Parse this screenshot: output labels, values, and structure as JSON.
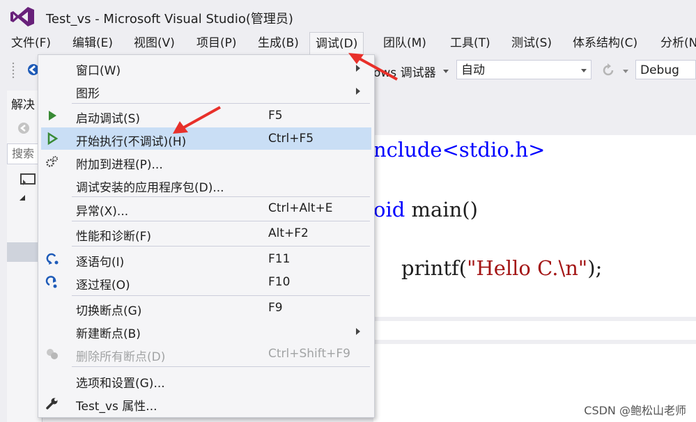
{
  "window": {
    "title": "Test_vs - Microsoft Visual Studio(管理员)"
  },
  "menubar": {
    "items": [
      "文件(F)",
      "编辑(E)",
      "视图(V)",
      "项目(P)",
      "生成(B)",
      "调试(D)",
      "团队(M)",
      "工具(T)",
      "测试(S)",
      "体系结构(C)",
      "分析(N"
    ],
    "active": "调试(D)"
  },
  "toolbar": {
    "debugger_label": "ows 调试器",
    "target_combo": "自动",
    "config_combo": "Debug"
  },
  "solution_explorer": {
    "title": "解决",
    "search_placeholder": "搜索"
  },
  "editor": {
    "line1": "nclude<stdio.h>",
    "line2_kw": "oid",
    "line2_rest": " main()",
    "line3_fn": "printf(",
    "line3_str": "\"Hello C.\\n\"",
    "line3_end": ");"
  },
  "debug_menu": {
    "items": [
      {
        "label": "窗口(W)",
        "shortcut": "",
        "submenu": true,
        "icon": ""
      },
      {
        "label": "图形",
        "shortcut": "",
        "submenu": true,
        "icon": ""
      },
      {
        "label": "启动调试(S)",
        "shortcut": "F5",
        "icon": "play-filled-icon"
      },
      {
        "label": "开始执行(不调试)(H)",
        "shortcut": "Ctrl+F5",
        "icon": "play-outline-icon",
        "highlighted": true
      },
      {
        "label": "附加到进程(P)...",
        "shortcut": "",
        "icon": "gears-icon"
      },
      {
        "label": "调试安装的应用程序包(D)...",
        "shortcut": "",
        "icon": ""
      },
      {
        "label": "异常(X)...",
        "shortcut": "Ctrl+Alt+E",
        "icon": ""
      },
      {
        "label": "性能和诊断(F)",
        "shortcut": "Alt+F2",
        "icon": ""
      },
      {
        "label": "逐语句(I)",
        "shortcut": "F11",
        "icon": "step-into-icon"
      },
      {
        "label": "逐过程(O)",
        "shortcut": "F10",
        "icon": "step-over-icon"
      },
      {
        "label": "切换断点(G)",
        "shortcut": "F9",
        "icon": ""
      },
      {
        "label": "新建断点(B)",
        "shortcut": "",
        "submenu": true,
        "icon": ""
      },
      {
        "label": "删除所有断点(D)",
        "shortcut": "Ctrl+Shift+F9",
        "icon": "delete-breakpoints-icon",
        "disabled": true
      },
      {
        "label": "选项和设置(G)...",
        "shortcut": "",
        "icon": ""
      },
      {
        "label": "Test_vs 属性...",
        "shortcut": "",
        "icon": "wrench-icon"
      }
    ]
  },
  "watermark": "CSDN @鲍松山老师",
  "colors": {
    "accent": "#68217a",
    "play_green": "#388a34",
    "highlight": "#c9def5",
    "keyword": "#0000ff",
    "string": "#a31515",
    "arrow_red": "#e8302a"
  }
}
